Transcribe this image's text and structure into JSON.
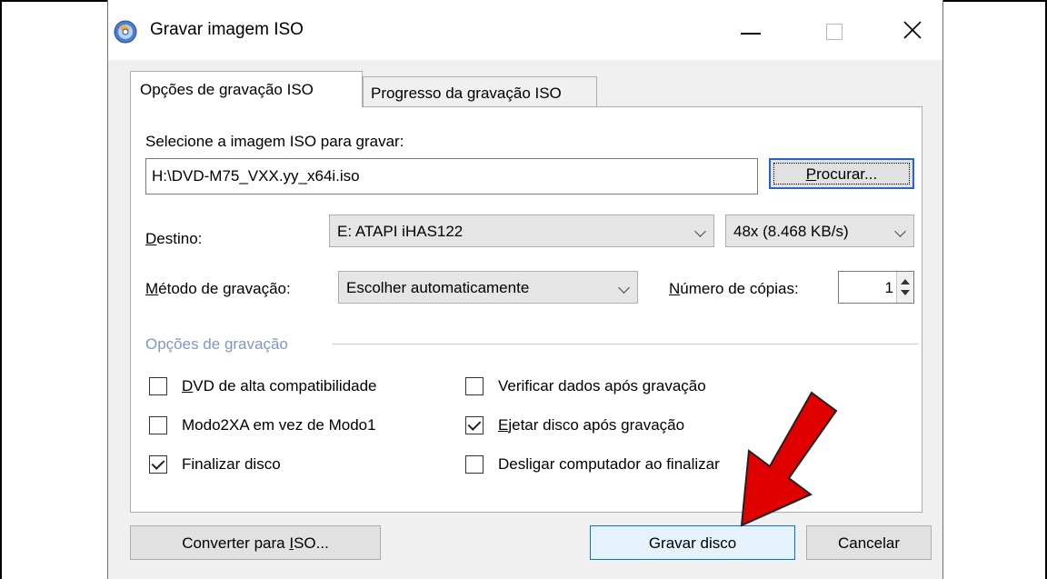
{
  "window": {
    "title": "Gravar imagem ISO",
    "controls": [
      "minimize-icon",
      "maximize-icon",
      "close-icon"
    ]
  },
  "tabs": [
    {
      "label": "Opções de gravação ISO",
      "active": true
    },
    {
      "label": "Progresso da gravação ISO",
      "active": false
    }
  ],
  "form": {
    "select_label": "Selecione a imagem ISO para gravar:",
    "iso_path": "H:\\DVD-M75_VXX.yy_x64i.iso",
    "browse_label_pre": "",
    "browse_label_u": "P",
    "browse_label_post": "rocurar...",
    "dest_label_u": "D",
    "dest_label_post": "estino:",
    "dest_drive": "E: ATAPI iHAS122",
    "dest_speed": "48x (8.468 KB/s)",
    "method_label_u": "M",
    "method_label_post": "étodo de gravação:",
    "method_value": "Escolher automaticamente",
    "copies_label_u": "N",
    "copies_label_post": "úmero de cópias:",
    "copies_value": "1"
  },
  "options": {
    "group_title": "Opções de gravação",
    "items": [
      {
        "label_u": "D",
        "label_post": "VD de alta compatibilidade",
        "checked": false
      },
      {
        "label_u": "",
        "label_post": "Modo2XA em vez de Modo1",
        "checked": false
      },
      {
        "label_u": "",
        "label_post": "Finalizar disco",
        "checked": true
      },
      {
        "label_u": "",
        "label_post": "Verificar dados após gravação",
        "checked": false
      },
      {
        "label_u": "E",
        "label_post": "jetar disco após gravação",
        "checked": true
      },
      {
        "label_u": "",
        "label_post": "Desligar computador ao finalizar",
        "checked": false
      }
    ]
  },
  "footer": {
    "convert_label_pre": "Converter para ",
    "convert_label_u": "I",
    "convert_label_post": "SO...",
    "burn_label": "Gravar disco",
    "cancel_label": "Cancelar"
  },
  "colors": {
    "accent": "#2a64c5",
    "annotation_arrow": "#e00000"
  }
}
